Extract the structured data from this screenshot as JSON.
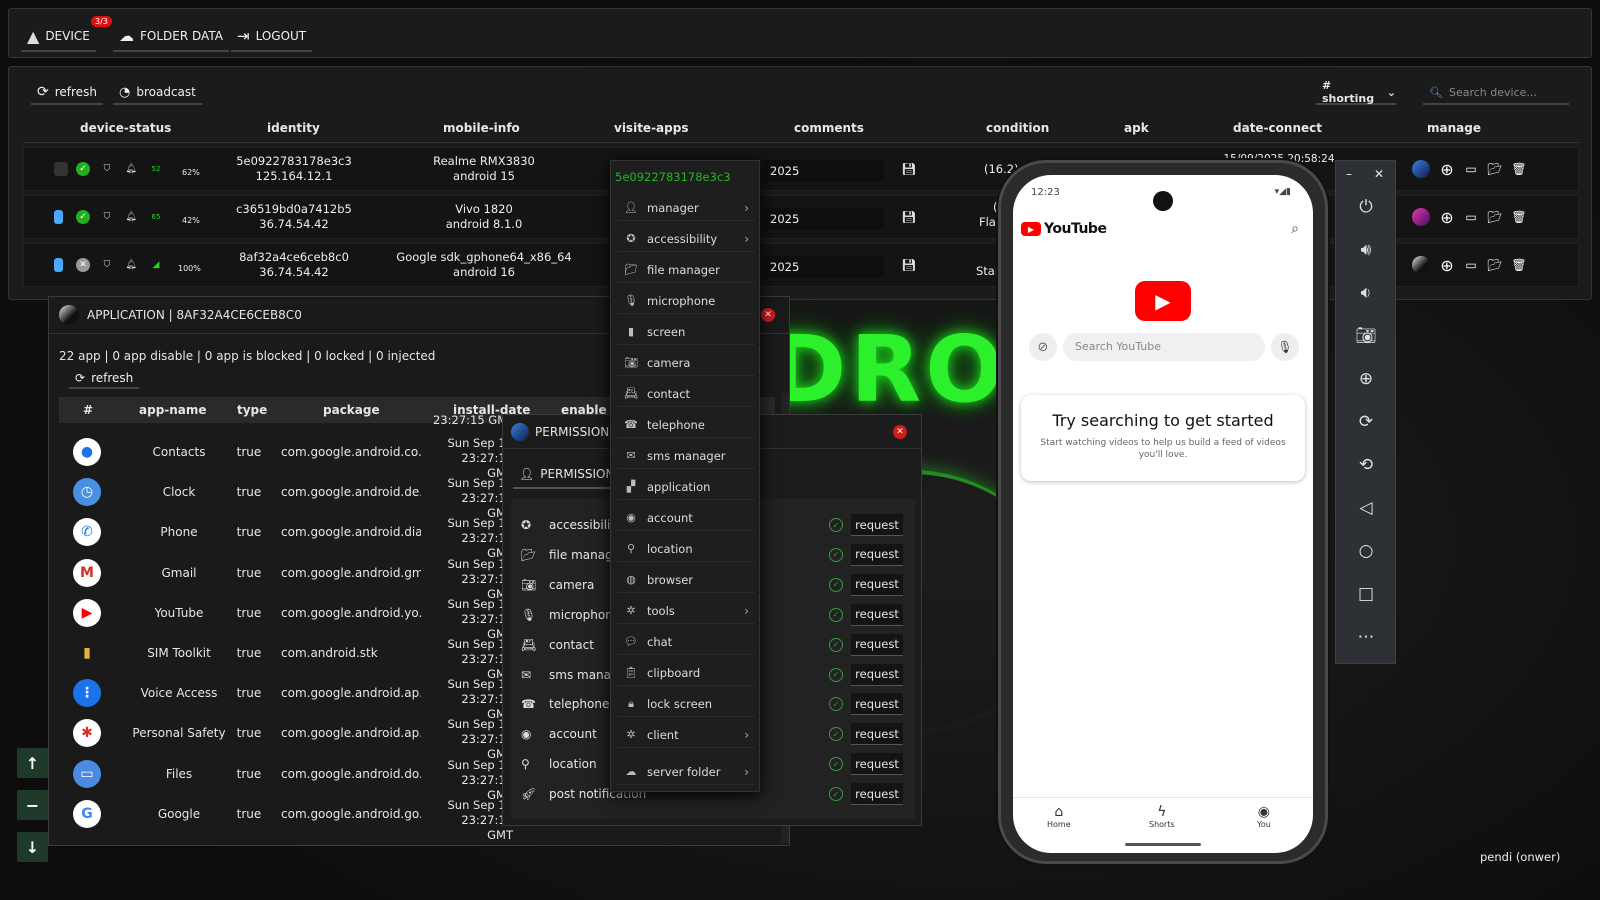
{
  "nav": {
    "device": "DEVICE",
    "device_badge": "3/3",
    "folder": "FOLDER DATA",
    "logout": "LOGOUT"
  },
  "toolbar": {
    "refresh": "refresh",
    "broadcast": "broadcast",
    "shorting": "# shorting",
    "search_placeholder": "Search device..."
  },
  "columns": [
    "device-status",
    "identity",
    "mobile-info",
    "visite-apps",
    "comments",
    "condition",
    "apk",
    "date-connect",
    "manage"
  ],
  "devices": [
    {
      "id": "5e0922783178e3c3",
      "ip": "125.164.12.1",
      "model": "Realme RMX3830",
      "os": "android 15",
      "comment": "2025",
      "condition": "(16.2) d",
      "date": "15/09/2025 20:58:24",
      "battery": "62%",
      "signal": "52"
    },
    {
      "id": "c36519bd0a7412b5",
      "ip": "36.74.54.42",
      "model": "Vivo 1820",
      "os": "android 8.1.0",
      "comment": "2025",
      "condition": "(1",
      "condition2": "Flat c",
      "battery": "42%",
      "signal": "65"
    },
    {
      "id": "8af32a4ce6ceb8c0",
      "ip": "36.74.54.42",
      "model": "Google sdk_gphone64_x86_64",
      "os": "android 16",
      "comment": "2025",
      "condition": "Stand",
      "battery": "100%"
    }
  ],
  "context_menu": {
    "device_id": "5e0922783178e3c3",
    "items": [
      "manager",
      "accessibility",
      "file manager",
      "microphone",
      "screen",
      "camera",
      "contact",
      "telephone",
      "sms manager",
      "application",
      "account",
      "location",
      "browser",
      "tools",
      "chat",
      "clipboard",
      "lock screen",
      "client",
      "server folder"
    ]
  },
  "app_window": {
    "title": "APPLICATION | 8AF32A4CE6CEB8C0",
    "stats": "22 app | 0 app disable | 0 app is blocked | 0 locked | 0 injected",
    "refresh": "refresh",
    "headers": [
      "#",
      "app-name",
      "type",
      "package",
      "install-date",
      "enable"
    ],
    "partial_date": "23:27:15 GMT",
    "apps": [
      {
        "name": "Contacts",
        "type": "true",
        "package": "com.google.android.co...",
        "date1": "Sun Sep 14",
        "date2": "23:27:15 GMT"
      },
      {
        "name": "Clock",
        "type": "true",
        "package": "com.google.android.de...",
        "date1": "Sun Sep 14",
        "date2": "23:27:15 GMT"
      },
      {
        "name": "Phone",
        "type": "true",
        "package": "com.google.android.dia...",
        "date1": "Sun Sep 14",
        "date2": "23:27:14 GMT"
      },
      {
        "name": "Gmail",
        "type": "true",
        "package": "com.google.android.gm",
        "date1": "Sun Sep 14",
        "date2": "23:27:15 GMT"
      },
      {
        "name": "YouTube",
        "type": "true",
        "package": "com.google.android.yo...",
        "date1": "Sun Sep 14",
        "date2": "23:27:15 GMT"
      },
      {
        "name": "SIM Toolkit",
        "type": "true",
        "package": "com.android.stk",
        "date1": "Sun Sep 14",
        "date2": "23:27:14 GMT"
      },
      {
        "name": "Voice Access",
        "type": "true",
        "package": "com.google.android.ap...",
        "date1": "Sun Sep 14",
        "date2": "23:27:15 GMT"
      },
      {
        "name": "Personal Safety",
        "type": "true",
        "package": "com.google.android.ap...",
        "date1": "Sun Sep 14",
        "date2": "23:27:14 GMT"
      },
      {
        "name": "Files",
        "type": "true",
        "package": "com.google.android.do...",
        "date1": "Sun Sep 14",
        "date2": "23:27:15 GMT"
      },
      {
        "name": "Google",
        "type": "true",
        "package": "com.google.android.go...",
        "date1": "Sun Sep 14",
        "date2": "23:27:15 GMT"
      }
    ]
  },
  "perm_window": {
    "title": "PERMISSION 5E",
    "tab": "PERMISSION",
    "request": "request",
    "items": [
      "accessibility",
      "file manage",
      "camera",
      "microphone",
      "contact",
      "sms manag",
      "telephone",
      "account",
      "location",
      "post notification"
    ]
  },
  "phone": {
    "time": "12:23",
    "app": "YouTube",
    "search_placeholder": "Search YouTube",
    "headline": "Try searching to get started",
    "sub1": "Start watching videos to help us build a feed of videos",
    "sub2": "you'll love.",
    "nav": [
      "Home",
      "Shorts",
      "You"
    ]
  },
  "footer": {
    "user": "pendi (onwer)"
  },
  "colors": {
    "accent_green": "#2bf02b",
    "close_red": "#d21b1b",
    "youtube_red": "#ff0000"
  }
}
